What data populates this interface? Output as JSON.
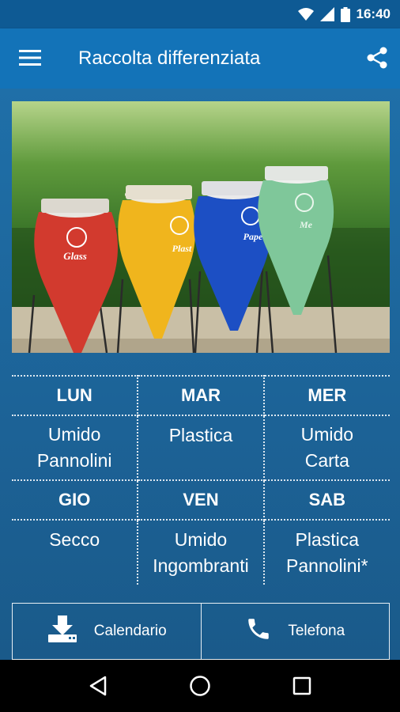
{
  "status_bar": {
    "time": "16:40",
    "icons": [
      "wifi-icon",
      "signal-icon",
      "battery-icon"
    ]
  },
  "app_bar": {
    "title": "Raccolta differenziata",
    "menu_icon": "menu-icon",
    "share_icon": "share-icon"
  },
  "photo": {
    "description_icon": "recycling-bins-photo",
    "bins": [
      {
        "label": "Glass",
        "color": "#d23a2e"
      },
      {
        "label": "Plastic",
        "color": "#f0b51d"
      },
      {
        "label": "Paper",
        "color": "#1c4fc4"
      },
      {
        "label": "Metal",
        "color": "#7fc79a"
      }
    ]
  },
  "schedule": {
    "rows": [
      {
        "days": [
          "LUN",
          "MAR",
          "MER"
        ],
        "items": [
          [
            "Umido",
            "Pannolini"
          ],
          [
            "Plastica"
          ],
          [
            "Umido",
            "Carta"
          ]
        ]
      },
      {
        "days": [
          "GIO",
          "VEN",
          "SAB"
        ],
        "items": [
          [
            "Secco"
          ],
          [
            "Umido",
            "Ingombranti"
          ],
          [
            "Plastica",
            "Pannolini*"
          ]
        ]
      }
    ]
  },
  "actions": {
    "calendar_label": "Calendario",
    "calendar_icon": "download-icon",
    "phone_label": "Telefona",
    "phone_icon": "phone-icon"
  },
  "nav_bar": {
    "icons": [
      "back-icon",
      "home-icon",
      "recents-icon"
    ]
  },
  "colors": {
    "status_bar": "#0e5a94",
    "app_bar": "#1373b8",
    "background": "#1c6296"
  }
}
